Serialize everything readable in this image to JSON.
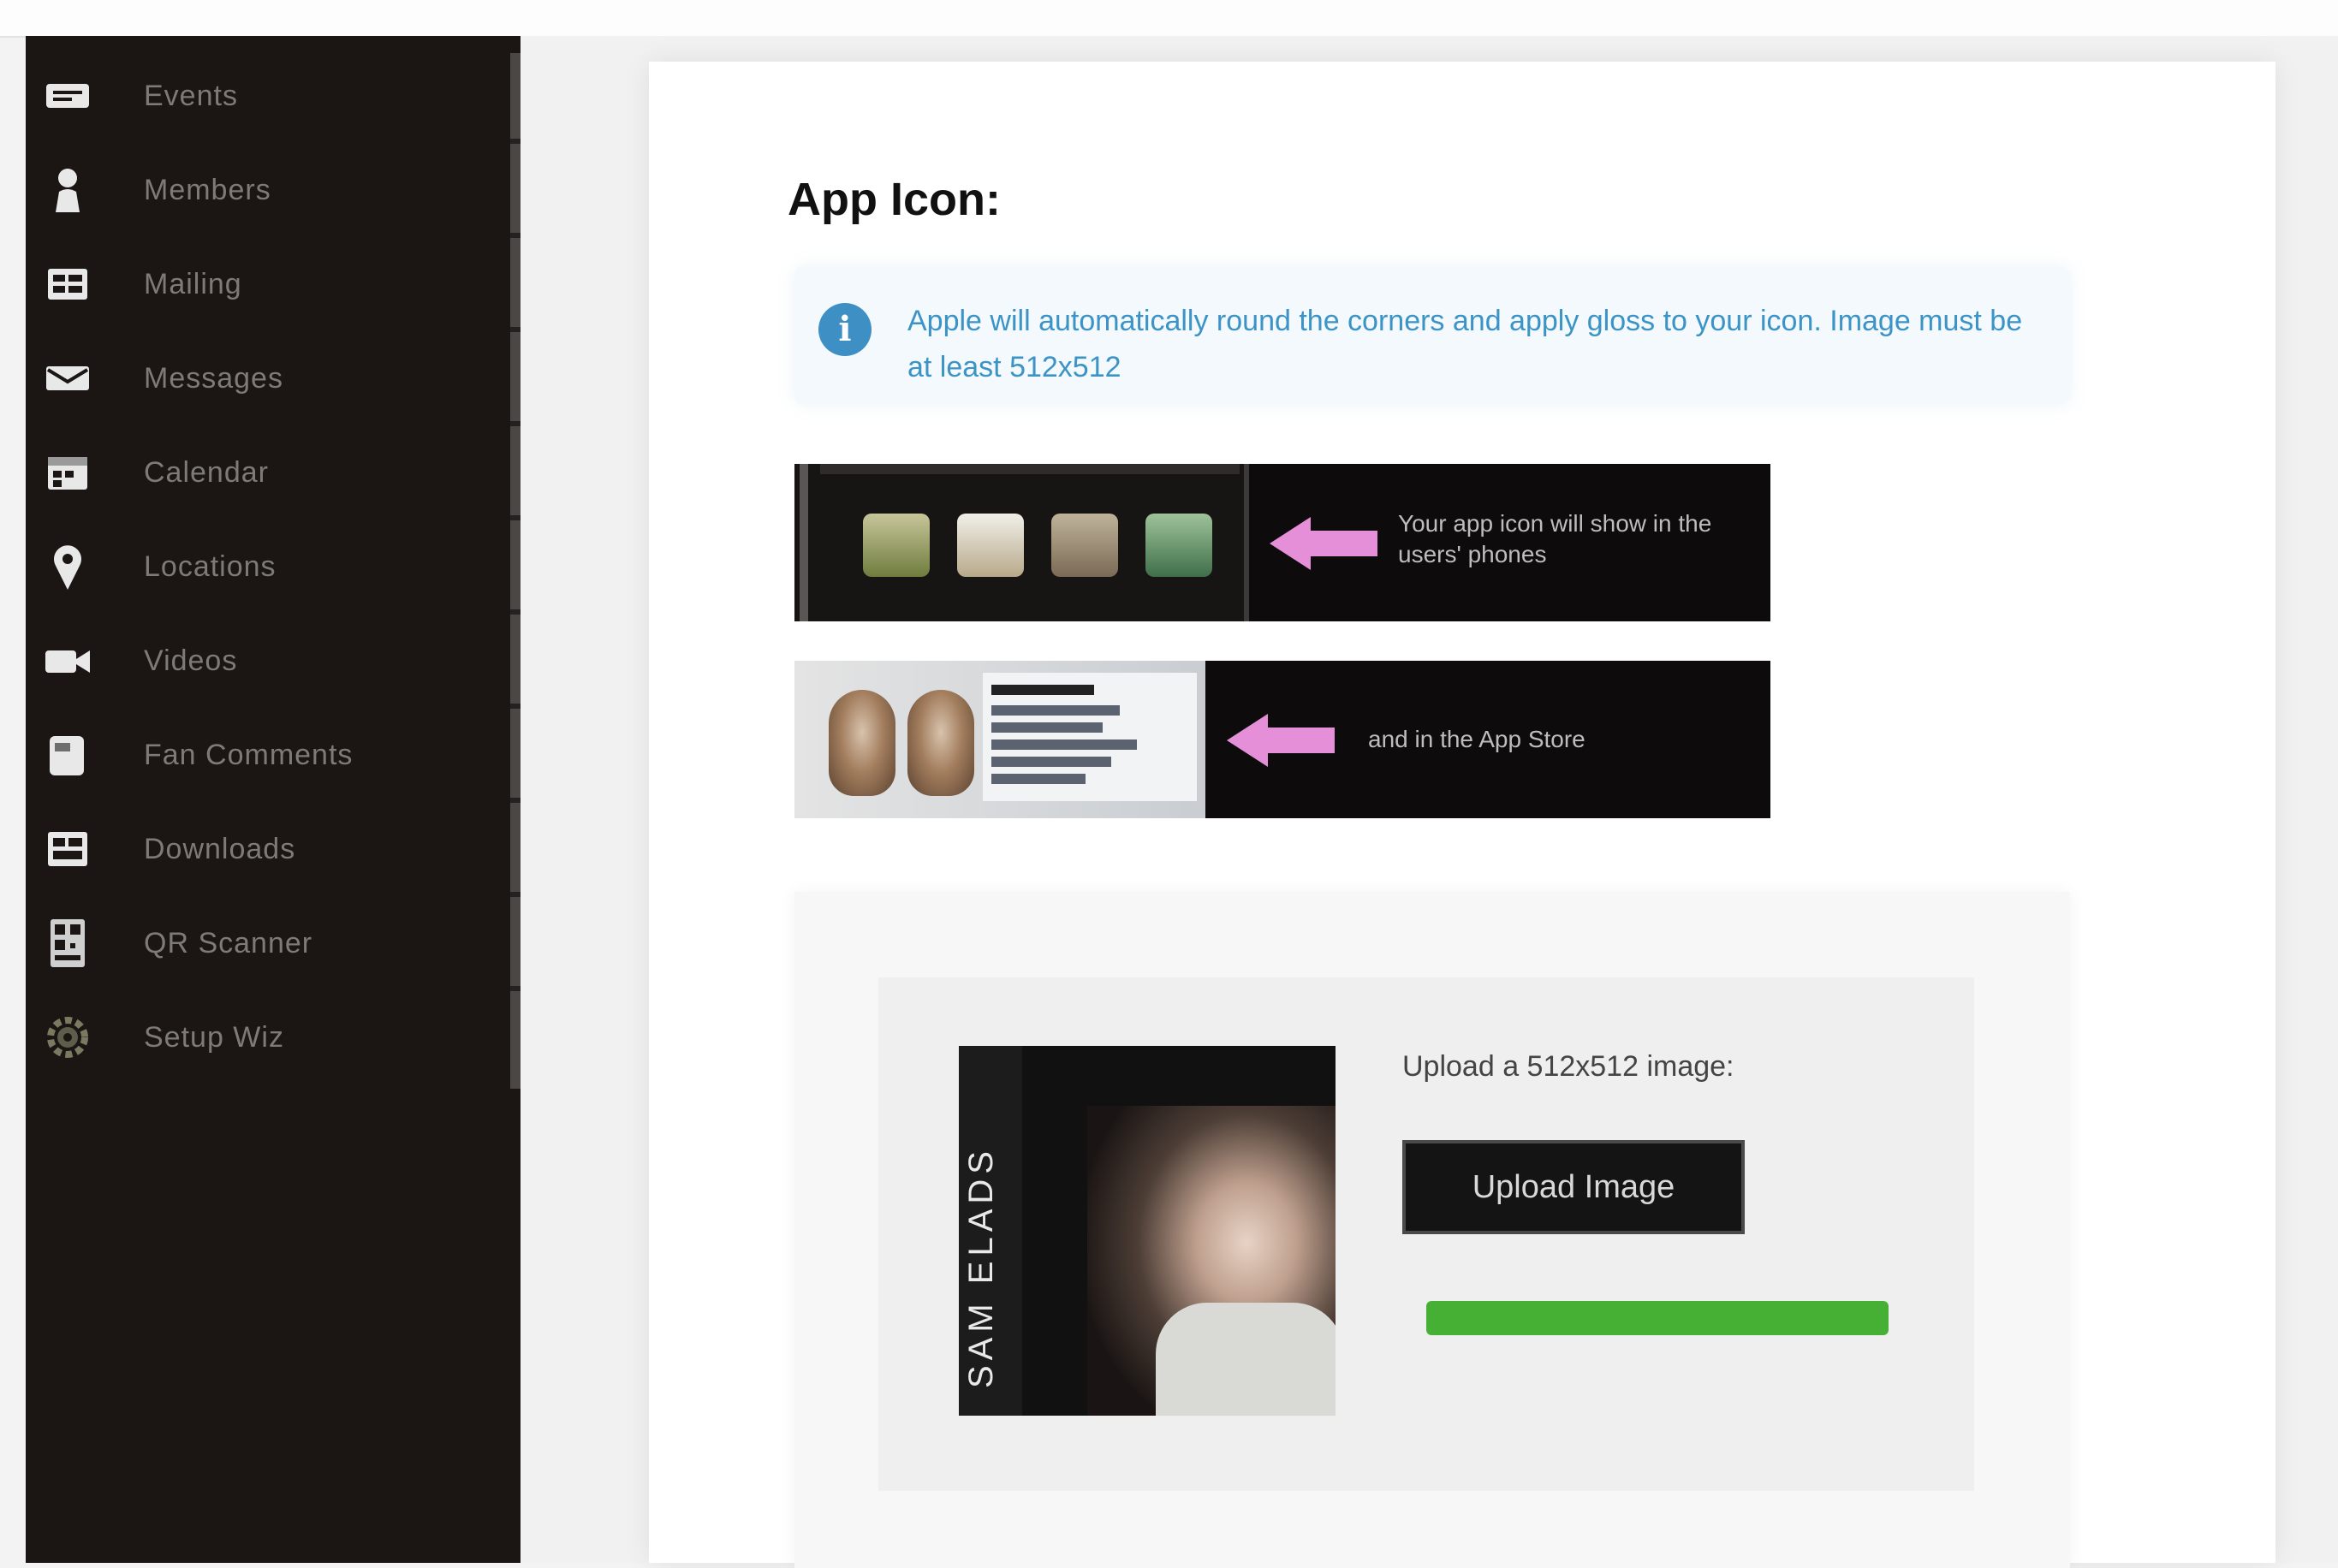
{
  "sidebar": {
    "items": [
      {
        "label": "Events",
        "icon": "ticket-icon"
      },
      {
        "label": "Members",
        "icon": "person-icon"
      },
      {
        "label": "Mailing",
        "icon": "list-icon"
      },
      {
        "label": "Messages",
        "icon": "envelope-icon"
      },
      {
        "label": "Calendar",
        "icon": "calendar-icon"
      },
      {
        "label": "Locations",
        "icon": "map-pin-icon"
      },
      {
        "label": "Videos",
        "icon": "video-icon"
      },
      {
        "label": "Fan Comments",
        "icon": "comment-icon"
      },
      {
        "label": "Downloads",
        "icon": "download-icon"
      },
      {
        "label": "QR Scanner",
        "icon": "qr-code-icon"
      },
      {
        "label": "Setup Wiz",
        "icon": "gear-icon"
      }
    ]
  },
  "main": {
    "section_title": "App Icon:",
    "info": {
      "icon": "info-icon",
      "text": "Apple will automatically round the corners and apply gloss to your icon. Image must be at least 512x512"
    },
    "banners": [
      {
        "text": "Your app icon will show in the users' phones",
        "arrow_color": "#e58fd8"
      },
      {
        "text": "and in the App Store",
        "arrow_color": "#e58fd8"
      }
    ],
    "upload": {
      "label": "Upload a 512x512 image:",
      "button_label": "Upload Image",
      "preview_text": "SAM ELADS",
      "progress": 1.0,
      "progress_color": "#45b034"
    }
  },
  "colors": {
    "sidebar_bg": "#1b1513",
    "accent_blue": "#3e8fc4"
  }
}
